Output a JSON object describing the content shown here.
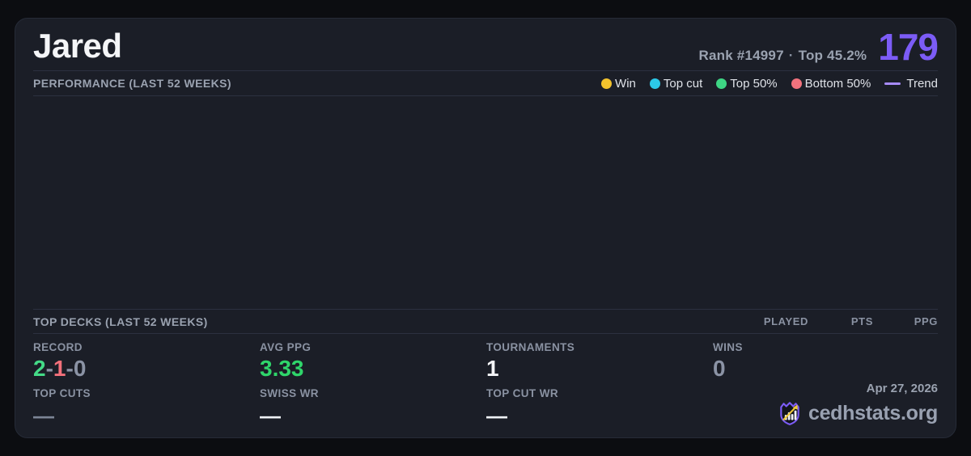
{
  "header": {
    "player_name": "Jared",
    "rank_text": "Rank #14997",
    "separator": "·",
    "top_percent_text": "Top 45.2%",
    "points": "179"
  },
  "performance": {
    "title": "PERFORMANCE (LAST 52 WEEKS)",
    "legend": {
      "items": [
        {
          "label": "Win",
          "color": "#f2c22d"
        },
        {
          "label": "Top cut",
          "color": "#2cc9e8"
        },
        {
          "label": "Top 50%",
          "color": "#3ed584"
        },
        {
          "label": "Bottom 50%",
          "color": "#f2727d"
        }
      ],
      "trend": {
        "label": "Trend",
        "color": "#a78bfa"
      }
    }
  },
  "top_decks": {
    "title": "TOP DECKS (LAST 52 WEEKS)",
    "columns": [
      "PLAYED",
      "PTS",
      "PPG"
    ]
  },
  "stats": {
    "record": {
      "label": "RECORD",
      "wins": "2",
      "losses": "1",
      "draws": "0",
      "separator": "-"
    },
    "avg_ppg": {
      "label": "AVG PPG",
      "value": "3.33"
    },
    "tournaments": {
      "label": "TOURNAMENTS",
      "value": "1"
    },
    "wins": {
      "label": "WINS",
      "value": "0"
    },
    "top_cuts": {
      "label": "TOP CUTS",
      "value": "—"
    },
    "swiss_wr": {
      "label": "SWISS WR",
      "value": "—"
    },
    "top_cut_wr": {
      "label": "TOP CUT WR",
      "value": "—"
    }
  },
  "footer": {
    "date": "Apr 27, 2026",
    "brand": "cedhstats.org"
  },
  "colors": {
    "background": "#0c0d11",
    "card": "#1b1e27",
    "accent_purple": "#7c5cf6",
    "win_green": "#44db87",
    "loss_red": "#f3707b",
    "draw_gray": "#8b93a5",
    "legend_win": "#f2c22d",
    "legend_top_cut": "#2cc9e8",
    "legend_top_50": "#3ed584",
    "legend_bottom_50": "#f2727d",
    "trend_purple": "#a78bfa"
  }
}
